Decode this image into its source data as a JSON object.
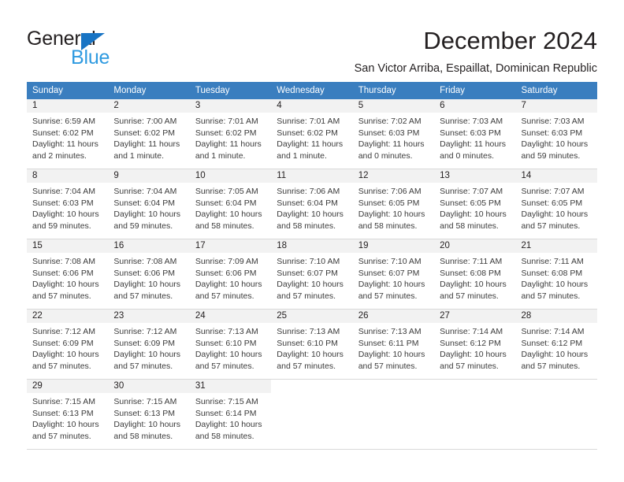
{
  "brand": {
    "name_top": "General",
    "name_bottom": "Blue",
    "color_dark": "#231f20",
    "color_blue": "#2e9ae0",
    "triangle_color": "#1874c4"
  },
  "header": {
    "title": "December 2024",
    "location": "San Victor Arriba, Espaillat, Dominican Republic",
    "header_bg": "#3a7ebf",
    "daynum_bg": "#f2f2f2"
  },
  "weekdays": [
    "Sunday",
    "Monday",
    "Tuesday",
    "Wednesday",
    "Thursday",
    "Friday",
    "Saturday"
  ],
  "weeks": [
    [
      {
        "day": "1",
        "sunrise": "Sunrise: 6:59 AM",
        "sunset": "Sunset: 6:02 PM",
        "daylight": "Daylight: 11 hours and 2 minutes."
      },
      {
        "day": "2",
        "sunrise": "Sunrise: 7:00 AM",
        "sunset": "Sunset: 6:02 PM",
        "daylight": "Daylight: 11 hours and 1 minute."
      },
      {
        "day": "3",
        "sunrise": "Sunrise: 7:01 AM",
        "sunset": "Sunset: 6:02 PM",
        "daylight": "Daylight: 11 hours and 1 minute."
      },
      {
        "day": "4",
        "sunrise": "Sunrise: 7:01 AM",
        "sunset": "Sunset: 6:02 PM",
        "daylight": "Daylight: 11 hours and 1 minute."
      },
      {
        "day": "5",
        "sunrise": "Sunrise: 7:02 AM",
        "sunset": "Sunset: 6:03 PM",
        "daylight": "Daylight: 11 hours and 0 minutes."
      },
      {
        "day": "6",
        "sunrise": "Sunrise: 7:03 AM",
        "sunset": "Sunset: 6:03 PM",
        "daylight": "Daylight: 11 hours and 0 minutes."
      },
      {
        "day": "7",
        "sunrise": "Sunrise: 7:03 AM",
        "sunset": "Sunset: 6:03 PM",
        "daylight": "Daylight: 10 hours and 59 minutes."
      }
    ],
    [
      {
        "day": "8",
        "sunrise": "Sunrise: 7:04 AM",
        "sunset": "Sunset: 6:03 PM",
        "daylight": "Daylight: 10 hours and 59 minutes."
      },
      {
        "day": "9",
        "sunrise": "Sunrise: 7:04 AM",
        "sunset": "Sunset: 6:04 PM",
        "daylight": "Daylight: 10 hours and 59 minutes."
      },
      {
        "day": "10",
        "sunrise": "Sunrise: 7:05 AM",
        "sunset": "Sunset: 6:04 PM",
        "daylight": "Daylight: 10 hours and 58 minutes."
      },
      {
        "day": "11",
        "sunrise": "Sunrise: 7:06 AM",
        "sunset": "Sunset: 6:04 PM",
        "daylight": "Daylight: 10 hours and 58 minutes."
      },
      {
        "day": "12",
        "sunrise": "Sunrise: 7:06 AM",
        "sunset": "Sunset: 6:05 PM",
        "daylight": "Daylight: 10 hours and 58 minutes."
      },
      {
        "day": "13",
        "sunrise": "Sunrise: 7:07 AM",
        "sunset": "Sunset: 6:05 PM",
        "daylight": "Daylight: 10 hours and 58 minutes."
      },
      {
        "day": "14",
        "sunrise": "Sunrise: 7:07 AM",
        "sunset": "Sunset: 6:05 PM",
        "daylight": "Daylight: 10 hours and 57 minutes."
      }
    ],
    [
      {
        "day": "15",
        "sunrise": "Sunrise: 7:08 AM",
        "sunset": "Sunset: 6:06 PM",
        "daylight": "Daylight: 10 hours and 57 minutes."
      },
      {
        "day": "16",
        "sunrise": "Sunrise: 7:08 AM",
        "sunset": "Sunset: 6:06 PM",
        "daylight": "Daylight: 10 hours and 57 minutes."
      },
      {
        "day": "17",
        "sunrise": "Sunrise: 7:09 AM",
        "sunset": "Sunset: 6:06 PM",
        "daylight": "Daylight: 10 hours and 57 minutes."
      },
      {
        "day": "18",
        "sunrise": "Sunrise: 7:10 AM",
        "sunset": "Sunset: 6:07 PM",
        "daylight": "Daylight: 10 hours and 57 minutes."
      },
      {
        "day": "19",
        "sunrise": "Sunrise: 7:10 AM",
        "sunset": "Sunset: 6:07 PM",
        "daylight": "Daylight: 10 hours and 57 minutes."
      },
      {
        "day": "20",
        "sunrise": "Sunrise: 7:11 AM",
        "sunset": "Sunset: 6:08 PM",
        "daylight": "Daylight: 10 hours and 57 minutes."
      },
      {
        "day": "21",
        "sunrise": "Sunrise: 7:11 AM",
        "sunset": "Sunset: 6:08 PM",
        "daylight": "Daylight: 10 hours and 57 minutes."
      }
    ],
    [
      {
        "day": "22",
        "sunrise": "Sunrise: 7:12 AM",
        "sunset": "Sunset: 6:09 PM",
        "daylight": "Daylight: 10 hours and 57 minutes."
      },
      {
        "day": "23",
        "sunrise": "Sunrise: 7:12 AM",
        "sunset": "Sunset: 6:09 PM",
        "daylight": "Daylight: 10 hours and 57 minutes."
      },
      {
        "day": "24",
        "sunrise": "Sunrise: 7:13 AM",
        "sunset": "Sunset: 6:10 PM",
        "daylight": "Daylight: 10 hours and 57 minutes."
      },
      {
        "day": "25",
        "sunrise": "Sunrise: 7:13 AM",
        "sunset": "Sunset: 6:10 PM",
        "daylight": "Daylight: 10 hours and 57 minutes."
      },
      {
        "day": "26",
        "sunrise": "Sunrise: 7:13 AM",
        "sunset": "Sunset: 6:11 PM",
        "daylight": "Daylight: 10 hours and 57 minutes."
      },
      {
        "day": "27",
        "sunrise": "Sunrise: 7:14 AM",
        "sunset": "Sunset: 6:12 PM",
        "daylight": "Daylight: 10 hours and 57 minutes."
      },
      {
        "day": "28",
        "sunrise": "Sunrise: 7:14 AM",
        "sunset": "Sunset: 6:12 PM",
        "daylight": "Daylight: 10 hours and 57 minutes."
      }
    ],
    [
      {
        "day": "29",
        "sunrise": "Sunrise: 7:15 AM",
        "sunset": "Sunset: 6:13 PM",
        "daylight": "Daylight: 10 hours and 57 minutes."
      },
      {
        "day": "30",
        "sunrise": "Sunrise: 7:15 AM",
        "sunset": "Sunset: 6:13 PM",
        "daylight": "Daylight: 10 hours and 58 minutes."
      },
      {
        "day": "31",
        "sunrise": "Sunrise: 7:15 AM",
        "sunset": "Sunset: 6:14 PM",
        "daylight": "Daylight: 10 hours and 58 minutes."
      },
      {
        "day": "",
        "sunrise": "",
        "sunset": "",
        "daylight": ""
      },
      {
        "day": "",
        "sunrise": "",
        "sunset": "",
        "daylight": ""
      },
      {
        "day": "",
        "sunrise": "",
        "sunset": "",
        "daylight": ""
      },
      {
        "day": "",
        "sunrise": "",
        "sunset": "",
        "daylight": ""
      }
    ]
  ]
}
